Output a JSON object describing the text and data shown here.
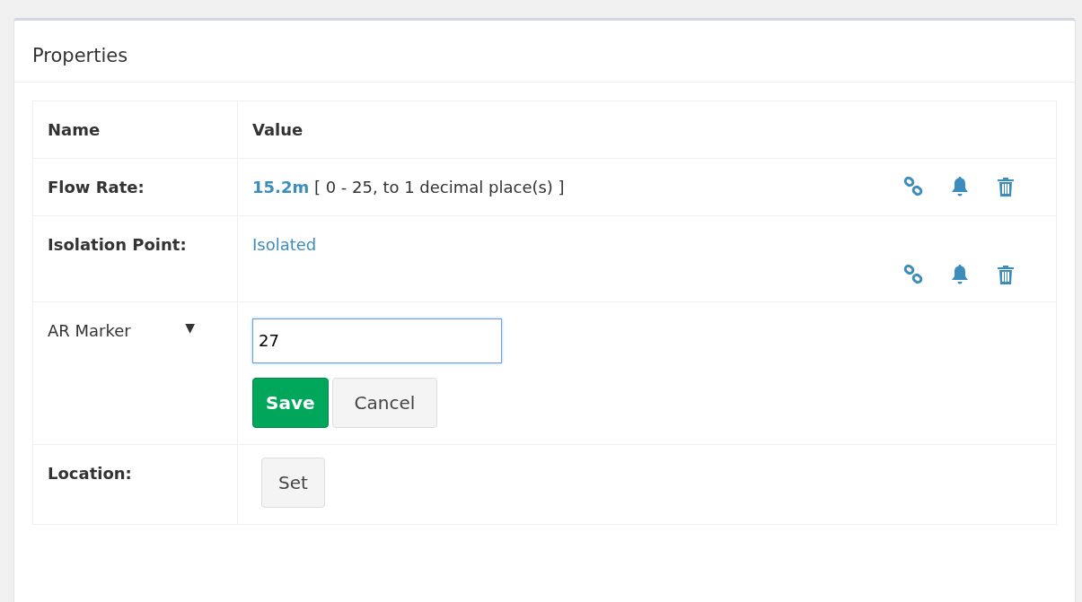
{
  "panel": {
    "title": "Properties"
  },
  "table": {
    "columns": [
      "Name",
      "Value"
    ],
    "rows": [
      {
        "kind": "reading",
        "label": "Flow Rate:",
        "value": "15.2m",
        "hint": "[ 0 - 25, to 1 decimal place(s) ]",
        "actions": true
      },
      {
        "kind": "state",
        "label": "Isolation Point:",
        "value": "Isolated",
        "actions": true
      },
      {
        "kind": "edit",
        "label": "AR Marker",
        "caret": "▼",
        "input_value": "27",
        "buttons": [
          {
            "label": "Save",
            "kind": "primary"
          },
          {
            "label": "Cancel",
            "kind": "secondary"
          }
        ]
      },
      {
        "kind": "action",
        "label": "Location:",
        "button": "Set"
      }
    ]
  }
}
